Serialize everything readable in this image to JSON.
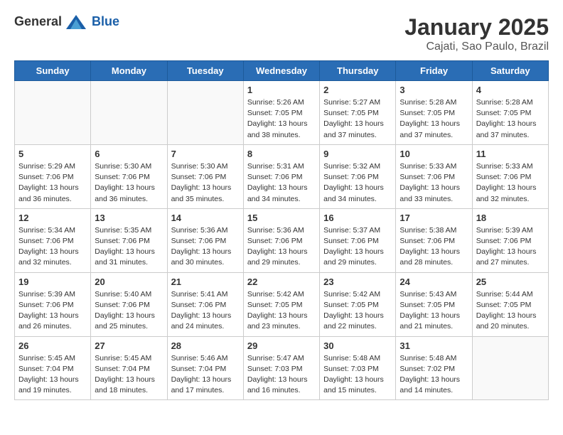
{
  "logo": {
    "text_general": "General",
    "text_blue": "Blue"
  },
  "header": {
    "title": "January 2025",
    "subtitle": "Cajati, Sao Paulo, Brazil"
  },
  "days_of_week": [
    "Sunday",
    "Monday",
    "Tuesday",
    "Wednesday",
    "Thursday",
    "Friday",
    "Saturday"
  ],
  "weeks": [
    {
      "days": [
        {
          "number": "",
          "info": ""
        },
        {
          "number": "",
          "info": ""
        },
        {
          "number": "",
          "info": ""
        },
        {
          "number": "1",
          "info": "Sunrise: 5:26 AM\nSunset: 7:05 PM\nDaylight: 13 hours\nand 38 minutes."
        },
        {
          "number": "2",
          "info": "Sunrise: 5:27 AM\nSunset: 7:05 PM\nDaylight: 13 hours\nand 37 minutes."
        },
        {
          "number": "3",
          "info": "Sunrise: 5:28 AM\nSunset: 7:05 PM\nDaylight: 13 hours\nand 37 minutes."
        },
        {
          "number": "4",
          "info": "Sunrise: 5:28 AM\nSunset: 7:05 PM\nDaylight: 13 hours\nand 37 minutes."
        }
      ]
    },
    {
      "days": [
        {
          "number": "5",
          "info": "Sunrise: 5:29 AM\nSunset: 7:06 PM\nDaylight: 13 hours\nand 36 minutes."
        },
        {
          "number": "6",
          "info": "Sunrise: 5:30 AM\nSunset: 7:06 PM\nDaylight: 13 hours\nand 36 minutes."
        },
        {
          "number": "7",
          "info": "Sunrise: 5:30 AM\nSunset: 7:06 PM\nDaylight: 13 hours\nand 35 minutes."
        },
        {
          "number": "8",
          "info": "Sunrise: 5:31 AM\nSunset: 7:06 PM\nDaylight: 13 hours\nand 34 minutes."
        },
        {
          "number": "9",
          "info": "Sunrise: 5:32 AM\nSunset: 7:06 PM\nDaylight: 13 hours\nand 34 minutes."
        },
        {
          "number": "10",
          "info": "Sunrise: 5:33 AM\nSunset: 7:06 PM\nDaylight: 13 hours\nand 33 minutes."
        },
        {
          "number": "11",
          "info": "Sunrise: 5:33 AM\nSunset: 7:06 PM\nDaylight: 13 hours\nand 32 minutes."
        }
      ]
    },
    {
      "days": [
        {
          "number": "12",
          "info": "Sunrise: 5:34 AM\nSunset: 7:06 PM\nDaylight: 13 hours\nand 32 minutes."
        },
        {
          "number": "13",
          "info": "Sunrise: 5:35 AM\nSunset: 7:06 PM\nDaylight: 13 hours\nand 31 minutes."
        },
        {
          "number": "14",
          "info": "Sunrise: 5:36 AM\nSunset: 7:06 PM\nDaylight: 13 hours\nand 30 minutes."
        },
        {
          "number": "15",
          "info": "Sunrise: 5:36 AM\nSunset: 7:06 PM\nDaylight: 13 hours\nand 29 minutes."
        },
        {
          "number": "16",
          "info": "Sunrise: 5:37 AM\nSunset: 7:06 PM\nDaylight: 13 hours\nand 29 minutes."
        },
        {
          "number": "17",
          "info": "Sunrise: 5:38 AM\nSunset: 7:06 PM\nDaylight: 13 hours\nand 28 minutes."
        },
        {
          "number": "18",
          "info": "Sunrise: 5:39 AM\nSunset: 7:06 PM\nDaylight: 13 hours\nand 27 minutes."
        }
      ]
    },
    {
      "days": [
        {
          "number": "19",
          "info": "Sunrise: 5:39 AM\nSunset: 7:06 PM\nDaylight: 13 hours\nand 26 minutes."
        },
        {
          "number": "20",
          "info": "Sunrise: 5:40 AM\nSunset: 7:06 PM\nDaylight: 13 hours\nand 25 minutes."
        },
        {
          "number": "21",
          "info": "Sunrise: 5:41 AM\nSunset: 7:06 PM\nDaylight: 13 hours\nand 24 minutes."
        },
        {
          "number": "22",
          "info": "Sunrise: 5:42 AM\nSunset: 7:05 PM\nDaylight: 13 hours\nand 23 minutes."
        },
        {
          "number": "23",
          "info": "Sunrise: 5:42 AM\nSunset: 7:05 PM\nDaylight: 13 hours\nand 22 minutes."
        },
        {
          "number": "24",
          "info": "Sunrise: 5:43 AM\nSunset: 7:05 PM\nDaylight: 13 hours\nand 21 minutes."
        },
        {
          "number": "25",
          "info": "Sunrise: 5:44 AM\nSunset: 7:05 PM\nDaylight: 13 hours\nand 20 minutes."
        }
      ]
    },
    {
      "days": [
        {
          "number": "26",
          "info": "Sunrise: 5:45 AM\nSunset: 7:04 PM\nDaylight: 13 hours\nand 19 minutes."
        },
        {
          "number": "27",
          "info": "Sunrise: 5:45 AM\nSunset: 7:04 PM\nDaylight: 13 hours\nand 18 minutes."
        },
        {
          "number": "28",
          "info": "Sunrise: 5:46 AM\nSunset: 7:04 PM\nDaylight: 13 hours\nand 17 minutes."
        },
        {
          "number": "29",
          "info": "Sunrise: 5:47 AM\nSunset: 7:03 PM\nDaylight: 13 hours\nand 16 minutes."
        },
        {
          "number": "30",
          "info": "Sunrise: 5:48 AM\nSunset: 7:03 PM\nDaylight: 13 hours\nand 15 minutes."
        },
        {
          "number": "31",
          "info": "Sunrise: 5:48 AM\nSunset: 7:02 PM\nDaylight: 13 hours\nand 14 minutes."
        },
        {
          "number": "",
          "info": ""
        }
      ]
    }
  ]
}
